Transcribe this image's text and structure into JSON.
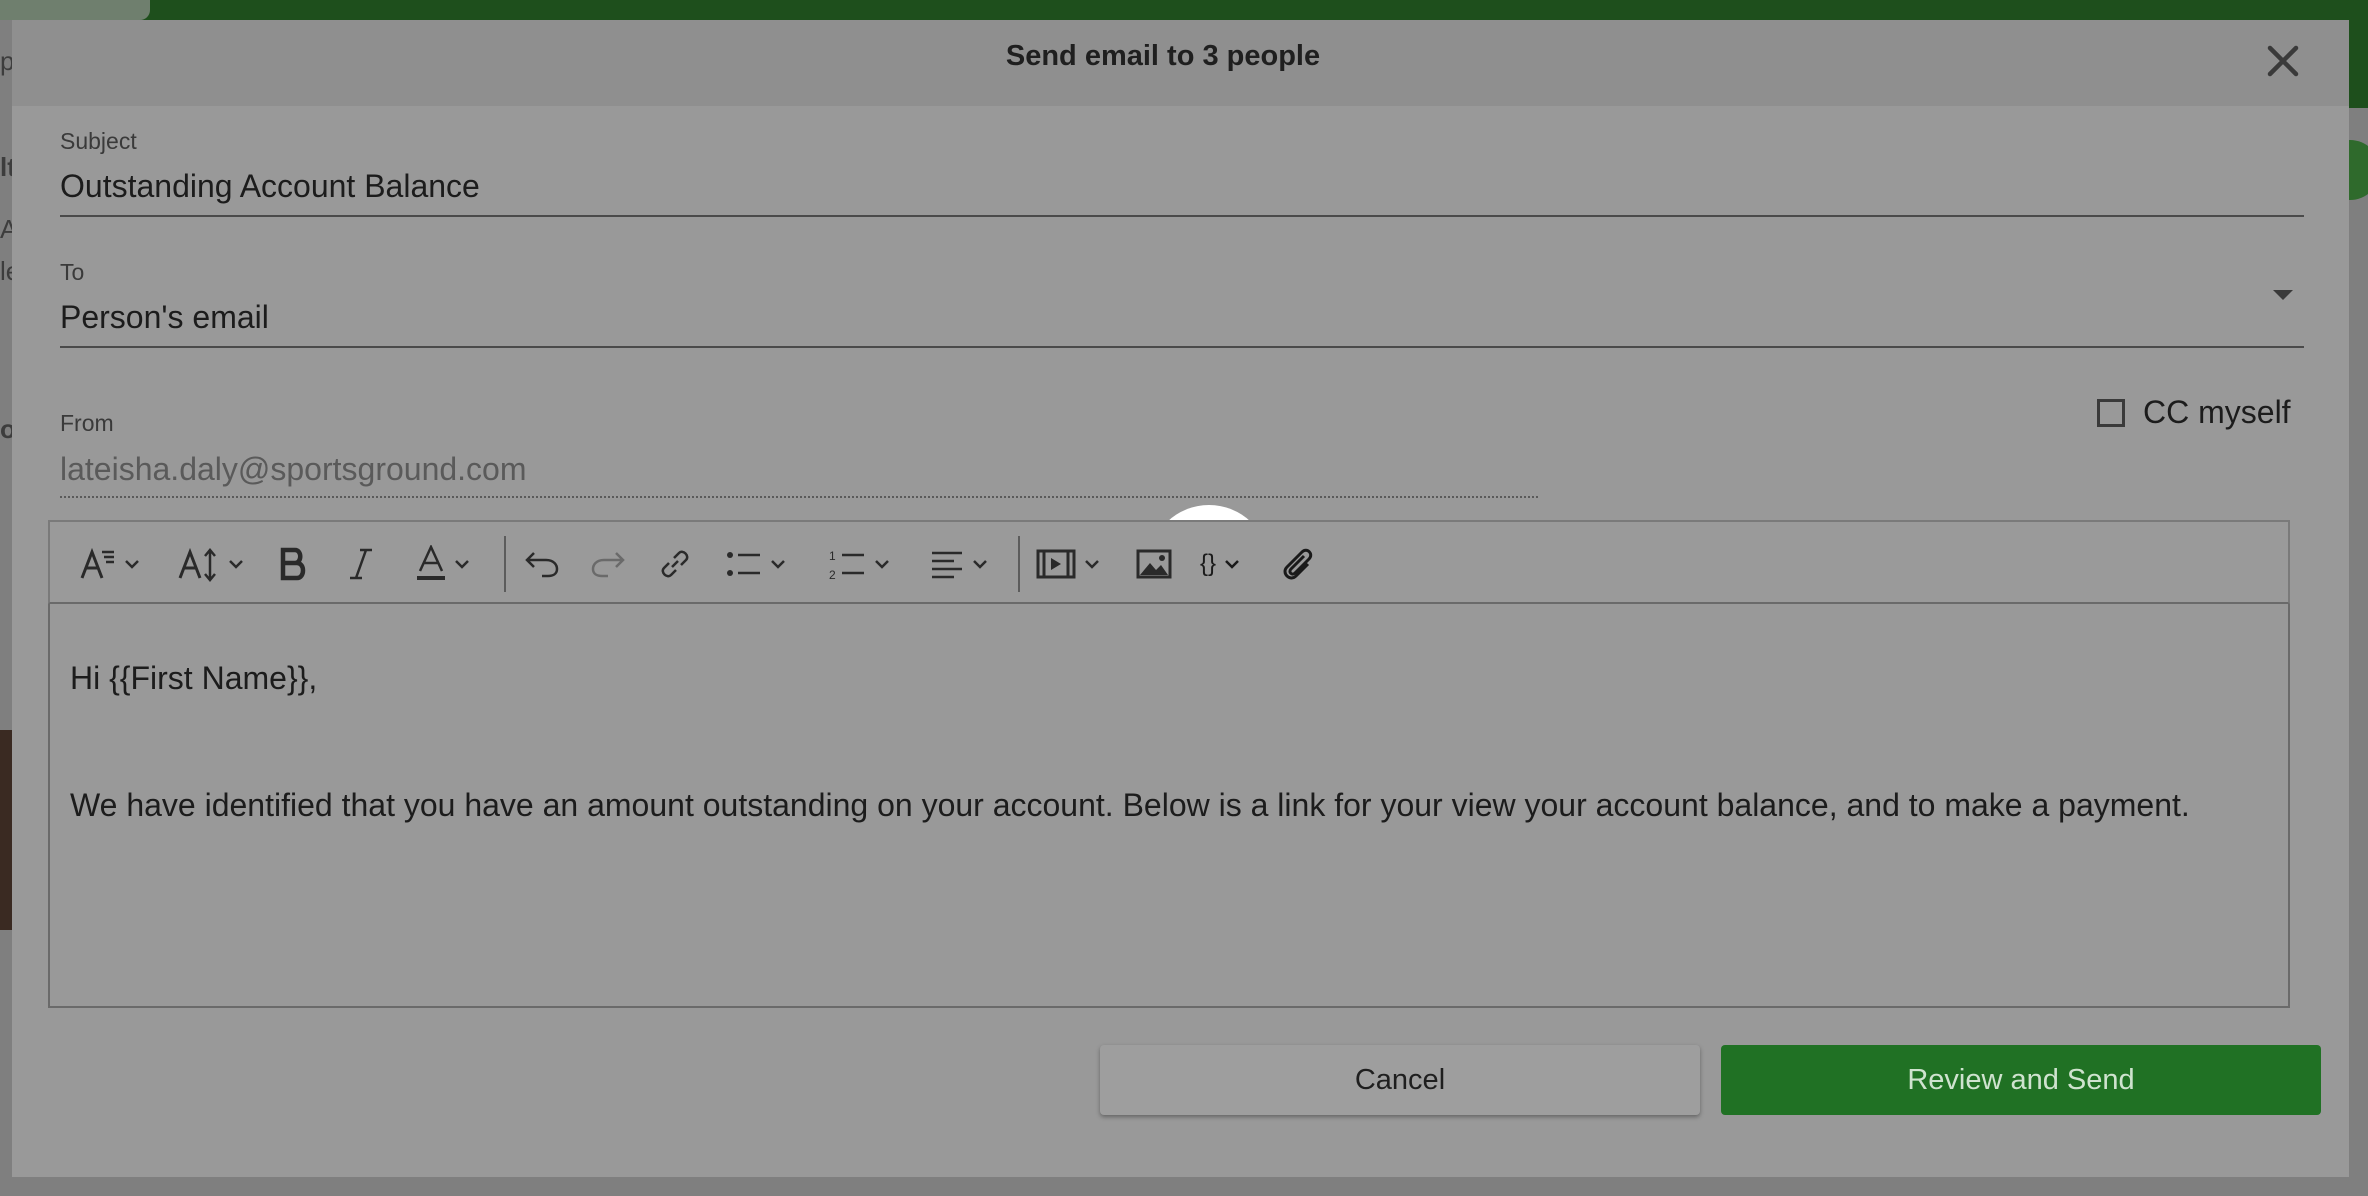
{
  "modal": {
    "title": "Send email to 3 people",
    "close_icon": "close-icon"
  },
  "subject": {
    "label": "Subject",
    "value": "Outstanding Account Balance"
  },
  "to": {
    "label": "To",
    "value": "Person's email",
    "dropdown_icon": "caret-down-icon"
  },
  "from": {
    "label": "From",
    "value": "lateisha.daly@sportsground.com"
  },
  "cc_myself": {
    "label": "CC myself",
    "checked": false
  },
  "toolbar": {
    "items": [
      "font-style-icon",
      "font-size-icon",
      "bold-icon",
      "italic-icon",
      "text-color-icon",
      "undo-icon",
      "redo-icon",
      "link-icon",
      "bulleted-list-icon",
      "numbered-list-icon",
      "align-icon",
      "video-icon",
      "image-icon",
      "merge-field-icon",
      "attachment-icon"
    ],
    "merge_field_glyph": "{}"
  },
  "editor": {
    "greeting": "Hi {{First Name}},",
    "body": "We have identified that you have an amount outstanding on your account. Below is a link for your view your account balance, and to make a payment."
  },
  "actions": {
    "cancel_label": "Cancel",
    "send_label": "Review and Send"
  },
  "colors": {
    "primary": "#207124",
    "overlay": "#999999"
  },
  "background": {
    "edge_chars": [
      "p",
      "lt",
      "A",
      "le",
      "o"
    ]
  }
}
